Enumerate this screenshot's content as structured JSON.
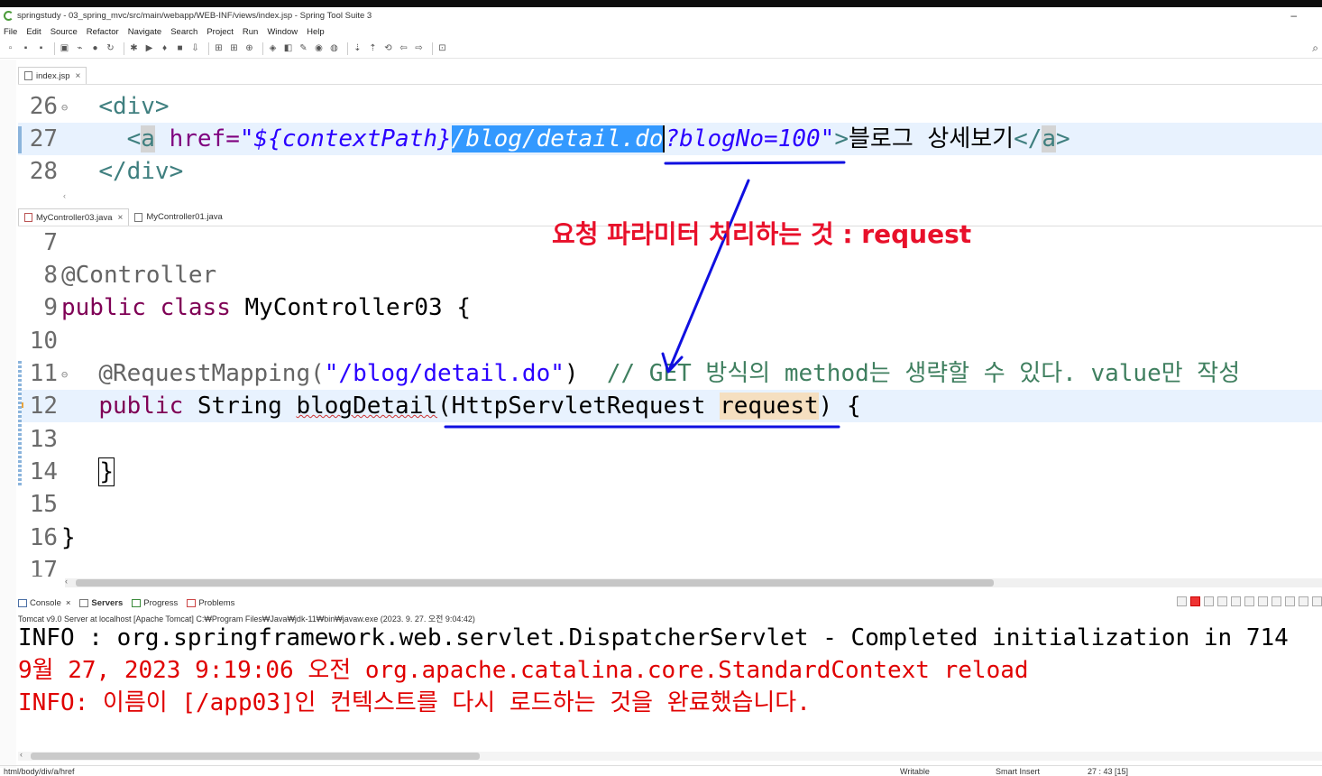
{
  "window": {
    "title": "springstudy - 03_spring_mvc/src/main/webapp/WEB-INF/views/index.jsp - Spring Tool Suite 3"
  },
  "menu": [
    "File",
    "Edit",
    "Source",
    "Refactor",
    "Navigate",
    "Search",
    "Project",
    "Run",
    "Window",
    "Help"
  ],
  "editor_top": {
    "tab": "index.jsp",
    "lines": {
      "l26": {
        "num": "26",
        "text": "<div>"
      },
      "l27": {
        "num": "27",
        "open": "<",
        "tagname": "a",
        "attr": " href=",
        "q1": "\"",
        "ctx": "${contextPath}",
        "selected": "/blog/detail.do",
        "query": "?blogNo=100",
        "q2": "\"",
        "close": ">",
        "label": "블로그 상세보기",
        "endtag": "</",
        "endname": "a",
        "endclose": ">"
      },
      "l28": {
        "num": "28",
        "text": "</div>"
      }
    }
  },
  "editor_bottom": {
    "tabs": [
      "MyController03.java",
      "MyController01.java"
    ],
    "lines": {
      "l7": {
        "num": "7"
      },
      "l8": {
        "num": "8",
        "text": "@Controller"
      },
      "l9": {
        "num": "9",
        "kw1": "public",
        "kw2": "class",
        "name": " MyController03 {"
      },
      "l10": {
        "num": "10"
      },
      "l11": {
        "num": "11",
        "ann": "@RequestMapping(",
        "str": "\"/blog/detail.do\"",
        "rest": ")  ",
        "comment": "// GET 방식의 method는 생략할 수 있다. value만 작성"
      },
      "l12": {
        "num": "12",
        "kw": "public",
        "type": " String ",
        "method": "blogDetail",
        "p1": "(HttpServletRequest ",
        "param": "request",
        "p2": ") {"
      },
      "l13": {
        "num": "13"
      },
      "l14": {
        "num": "14",
        "text": "}"
      },
      "l15": {
        "num": "15"
      },
      "l16": {
        "num": "16",
        "text": "}"
      },
      "l17": {
        "num": "17"
      }
    }
  },
  "console": {
    "tabs": [
      "Console",
      "Servers",
      "Progress",
      "Problems"
    ],
    "path": "Tomcat v9.0 Server at localhost [Apache Tomcat] C:₩Program Files₩Java₩jdk-11₩bin₩javaw.exe  (2023. 9. 27. 오전 9:04:42)",
    "lines": [
      "INFO : org.springframework.web.servlet.DispatcherServlet - Completed initialization in 714",
      "9월 27, 2023 9:19:06 오전 org.apache.catalina.core.StandardContext reload",
      "INFO: 이름이 [/app03]인 컨텍스트를 다시 로드하는 것을 완료했습니다."
    ]
  },
  "status": {
    "path": "html/body/div/a/href",
    "writable": "Writable",
    "insert": "Smart Insert",
    "position": "27 : 43 [15]"
  },
  "annotation": {
    "note": "요청 파라미터 처리하는 것 : request",
    "color": "#e8102a",
    "arrow_color": "#1010e0"
  }
}
